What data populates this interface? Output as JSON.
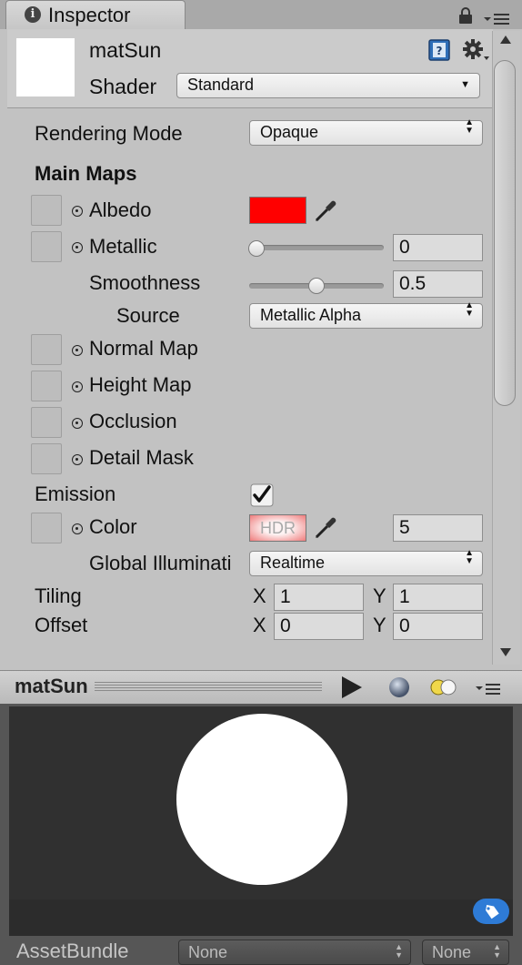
{
  "tab": {
    "title": "Inspector"
  },
  "header": {
    "material_name": "matSun",
    "shader_label": "Shader",
    "shader_value": "Standard"
  },
  "properties": {
    "rendering_mode_label": "Rendering Mode",
    "rendering_mode_value": "Opaque",
    "main_maps_heading": "Main Maps",
    "albedo_label": "Albedo",
    "albedo_color": "#ff0000",
    "metallic_label": "Metallic",
    "metallic_value": "0",
    "smoothness_label": "Smoothness",
    "smoothness_value": "0.5",
    "source_label": "Source",
    "source_value": "Metallic Alpha",
    "normal_map_label": "Normal Map",
    "height_map_label": "Height Map",
    "occlusion_label": "Occlusion",
    "detail_mask_label": "Detail Mask",
    "emission_label": "Emission",
    "emission_checked": true,
    "color_label": "Color",
    "hdr_label": "HDR",
    "emission_intensity": "5",
    "gi_label": "Global Illuminati",
    "gi_value": "Realtime",
    "tiling_label": "Tiling",
    "tiling_x_label": "X",
    "tiling_x": "1",
    "tiling_y_label": "Y",
    "tiling_y": "1",
    "offset_label": "Offset",
    "offset_x_label": "X",
    "offset_x": "0",
    "offset_y_label": "Y",
    "offset_y": "0"
  },
  "preview": {
    "title": "matSun",
    "assetbundle_label": "AssetBundle",
    "assetbundle_value": "None",
    "variant_value": "None"
  }
}
